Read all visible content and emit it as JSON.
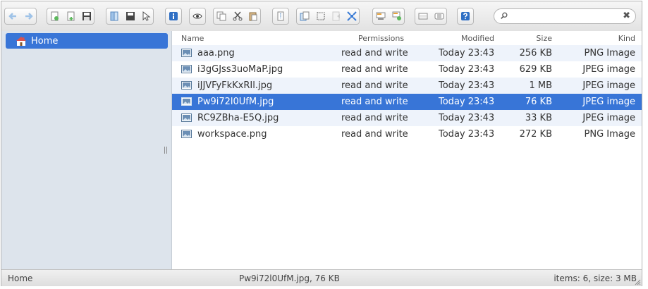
{
  "toolbar": {
    "groups": [
      [
        "back-icon",
        "forward-icon"
      ],
      [
        "new-folder-icon",
        "new-file-icon",
        "save-icon"
      ],
      [
        "open-icon",
        "save-as-icon",
        "select-icon"
      ],
      [
        "info-icon"
      ],
      [
        "preview-icon"
      ],
      [
        "copy-icon",
        "cut-icon",
        "paste-icon"
      ],
      [
        "extract-icon"
      ],
      [
        "duplicate-icon",
        "select-all-icon",
        "invert-selection-icon",
        "expand-icon"
      ],
      [
        "view-options-icon",
        "add-view-icon"
      ],
      [
        "list-view-icon",
        "sort-icon"
      ],
      [
        "help-icon"
      ]
    ],
    "search": {
      "placeholder": "",
      "value": ""
    }
  },
  "sidebar": {
    "items": [
      {
        "label": "Home",
        "icon": "home-icon",
        "selected": true
      }
    ]
  },
  "table": {
    "columns": {
      "name": "Name",
      "permissions": "Permissions",
      "modified": "Modified",
      "size": "Size",
      "kind": "Kind"
    },
    "rows": [
      {
        "name": "aaa.png",
        "permissions": "read and write",
        "modified": "Today 23:43",
        "size": "256 KB",
        "kind": "PNG Image",
        "selected": false
      },
      {
        "name": "i3gGJss3uoMaP.jpg",
        "permissions": "read and write",
        "modified": "Today 23:43",
        "size": "629 KB",
        "kind": "JPEG image",
        "selected": false
      },
      {
        "name": "iJJVFyFkKxRIl.jpg",
        "permissions": "read and write",
        "modified": "Today 23:43",
        "size": "1 MB",
        "kind": "JPEG image",
        "selected": false
      },
      {
        "name": "Pw9i72l0UfM.jpg",
        "permissions": "read and write",
        "modified": "Today 23:43",
        "size": "76 KB",
        "kind": "JPEG image",
        "selected": true
      },
      {
        "name": "RC9ZBha-E5Q.jpg",
        "permissions": "read and write",
        "modified": "Today 23:43",
        "size": "33 KB",
        "kind": "JPEG image",
        "selected": false
      },
      {
        "name": "workspace.png",
        "permissions": "read and write",
        "modified": "Today 23:43",
        "size": "272 KB",
        "kind": "PNG Image",
        "selected": false
      }
    ]
  },
  "status": {
    "path": "Home",
    "selection": "Pw9i72l0UfM.jpg, 76 KB",
    "summary": "items: 6, size: 3 MB"
  },
  "colors": {
    "accent": "#3875d7",
    "sidebar_bg": "#dde4ec",
    "alt_row": "#eef3fb"
  }
}
